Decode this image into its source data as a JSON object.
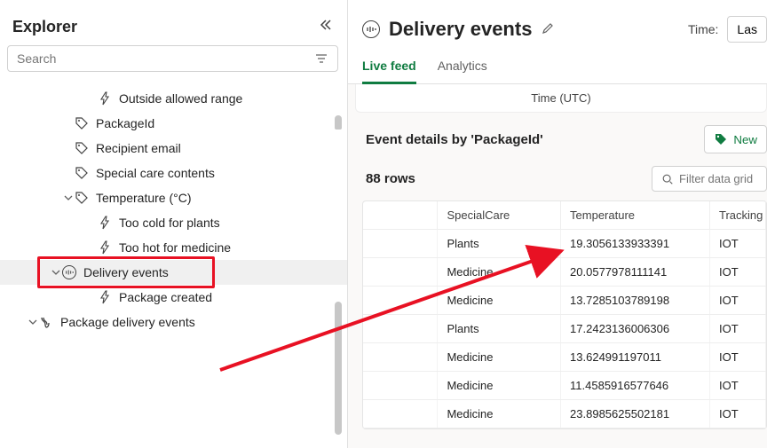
{
  "sidebar": {
    "title": "Explorer",
    "search_placeholder": "Search",
    "items": [
      {
        "label": "Outside allowed range",
        "icon": "bolt",
        "level": "pad-3",
        "chev": ""
      },
      {
        "label": "PackageId",
        "icon": "tag",
        "level": "pad-2",
        "chev": ""
      },
      {
        "label": "Recipient email",
        "icon": "tag",
        "level": "pad-2",
        "chev": ""
      },
      {
        "label": "Special care contents",
        "icon": "tag",
        "level": "pad-2",
        "chev": ""
      },
      {
        "label": "Temperature (°C)",
        "icon": "tag",
        "level": "pad-2",
        "chev": "down"
      },
      {
        "label": "Too cold for plants",
        "icon": "bolt",
        "level": "pad-3",
        "chev": ""
      },
      {
        "label": "Too hot for medicine",
        "icon": "bolt",
        "level": "pad-3",
        "chev": ""
      },
      {
        "label": "Delivery events",
        "icon": "events",
        "level": "pad-de",
        "chev": "down",
        "selected": true
      },
      {
        "label": "Package created",
        "icon": "bolt",
        "level": "pad-3",
        "chev": ""
      },
      {
        "label": "Package delivery events",
        "icon": "flow",
        "level": "pad-pde",
        "chev": "down"
      }
    ]
  },
  "main": {
    "title": "Delivery events",
    "time_label": "Time:",
    "time_value": "Las",
    "tabs": [
      {
        "label": "Live feed",
        "active": true
      },
      {
        "label": "Analytics",
        "active": false
      }
    ],
    "time_utc": "Time (UTC)",
    "details_title": "Event details by 'PackageId'",
    "new_button": "New",
    "row_count": "88 rows",
    "filter_placeholder": "Filter data grid",
    "grid": {
      "columns": [
        "",
        "SpecialCare",
        "Temperature",
        "Tracking"
      ],
      "rows": [
        [
          "",
          "Plants",
          "19.3056133933391",
          "IOT"
        ],
        [
          "",
          "Medicine",
          "20.0577978111141",
          "IOT"
        ],
        [
          "",
          "Medicine",
          "13.7285103789198",
          "IOT"
        ],
        [
          "",
          "Plants",
          "17.2423136006306",
          "IOT"
        ],
        [
          "",
          "Medicine",
          "13.624991197011",
          "IOT"
        ],
        [
          "",
          "Medicine",
          "11.4585916577646",
          "IOT"
        ],
        [
          "",
          "Medicine",
          "23.8985625502181",
          "IOT"
        ]
      ]
    }
  }
}
